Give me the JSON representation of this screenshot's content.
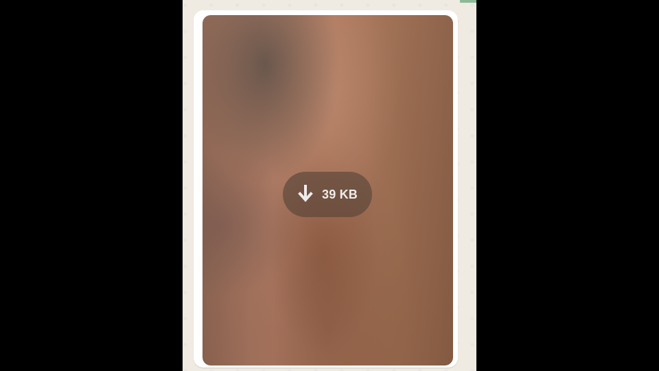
{
  "media_message": {
    "download_icon": "download-icon",
    "file_size": "39 KB",
    "colors": {
      "chat_background": "#efeae2",
      "bubble_background": "#ffffff",
      "download_pill_background": "#5f483a"
    }
  }
}
